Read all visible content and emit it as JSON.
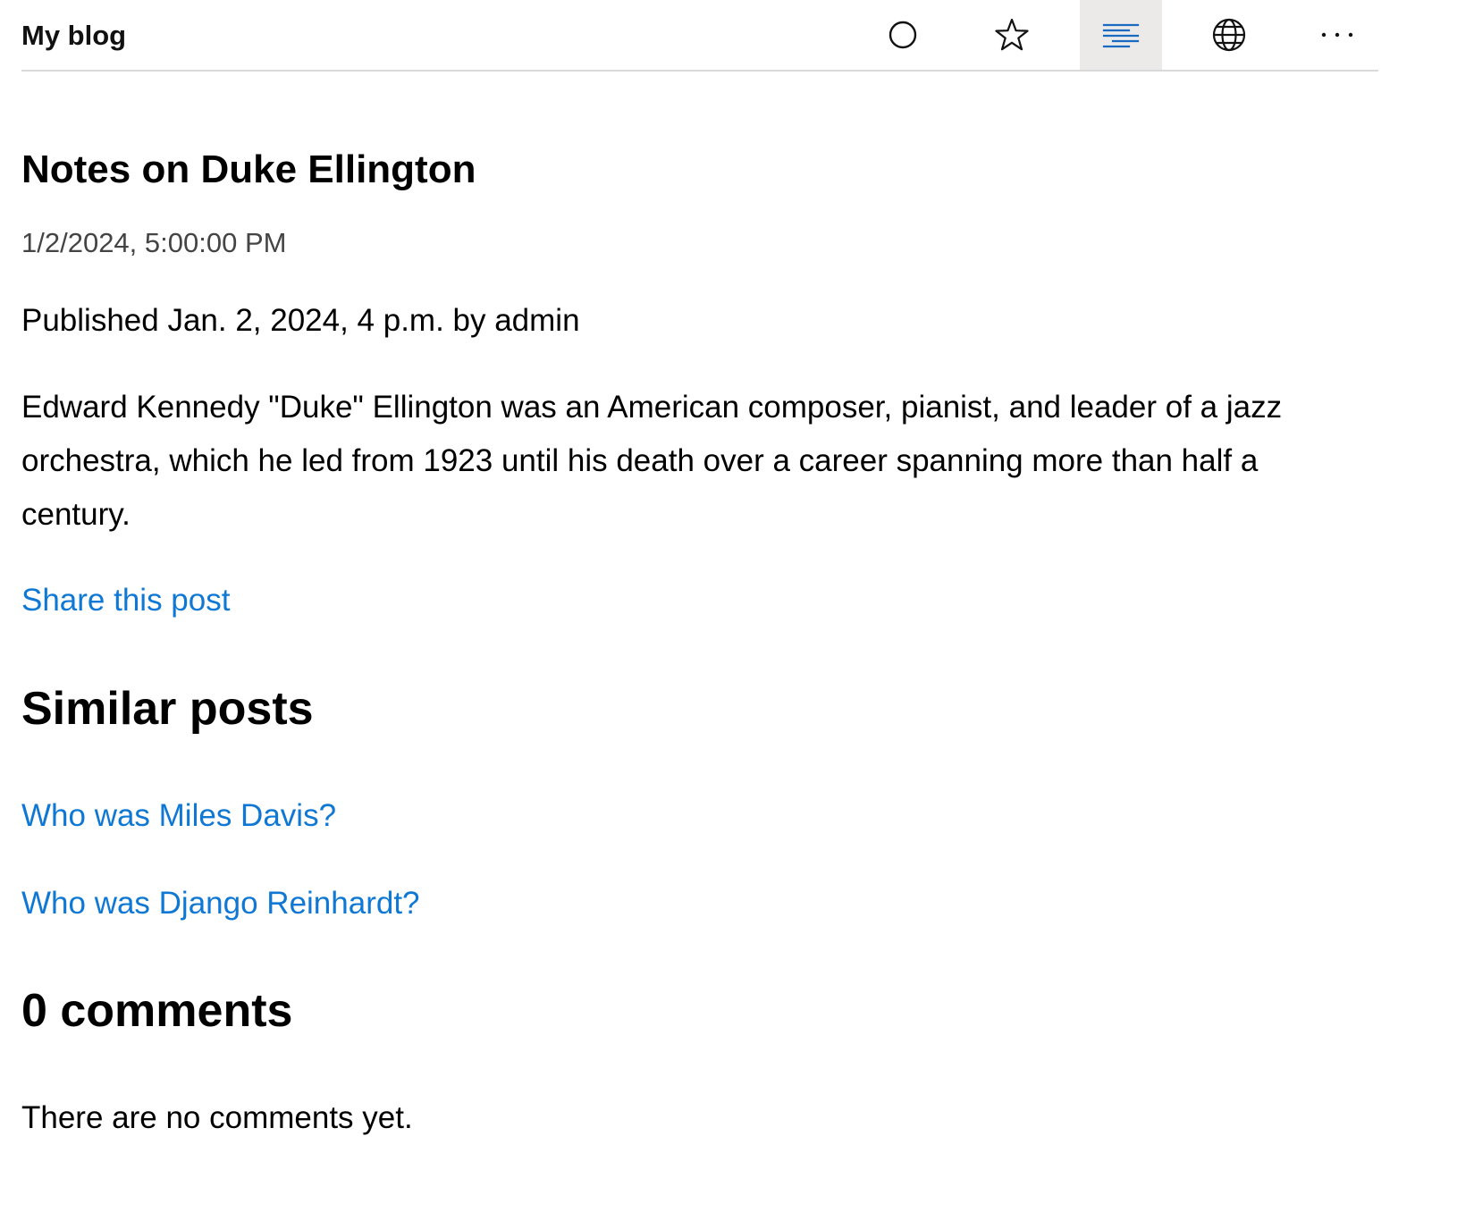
{
  "browser": {
    "title": "My blog",
    "toolbar": {
      "icons": [
        "reading-circle-icon",
        "favorite-star-icon",
        "reading-view-icon",
        "globe-icon",
        "more-icon"
      ],
      "active": "reading-view-icon",
      "accent_color": "#1a6ac2"
    }
  },
  "post": {
    "title": "Notes on Duke Ellington",
    "timestamp": "1/2/2024, 5:00:00 PM",
    "byline": "Published Jan. 2, 2024, 4 p.m. by admin",
    "body": "Edward Kennedy \"Duke\" Ellington was an American composer, pianist, and leader of a jazz orchestra, which he led from 1923 until his death over a career spanning more than half a century.",
    "share_label": "Share this post"
  },
  "similar": {
    "heading": "Similar posts",
    "items": [
      {
        "label": "Who was Miles Davis?"
      },
      {
        "label": "Who was Django Reinhardt?"
      }
    ]
  },
  "comments": {
    "heading": "0 comments",
    "empty_text": "There are no comments yet."
  },
  "colors": {
    "link": "#0f78d4",
    "text": "#000000",
    "muted": "#444444",
    "active_tool_bg": "#ebeae9"
  }
}
